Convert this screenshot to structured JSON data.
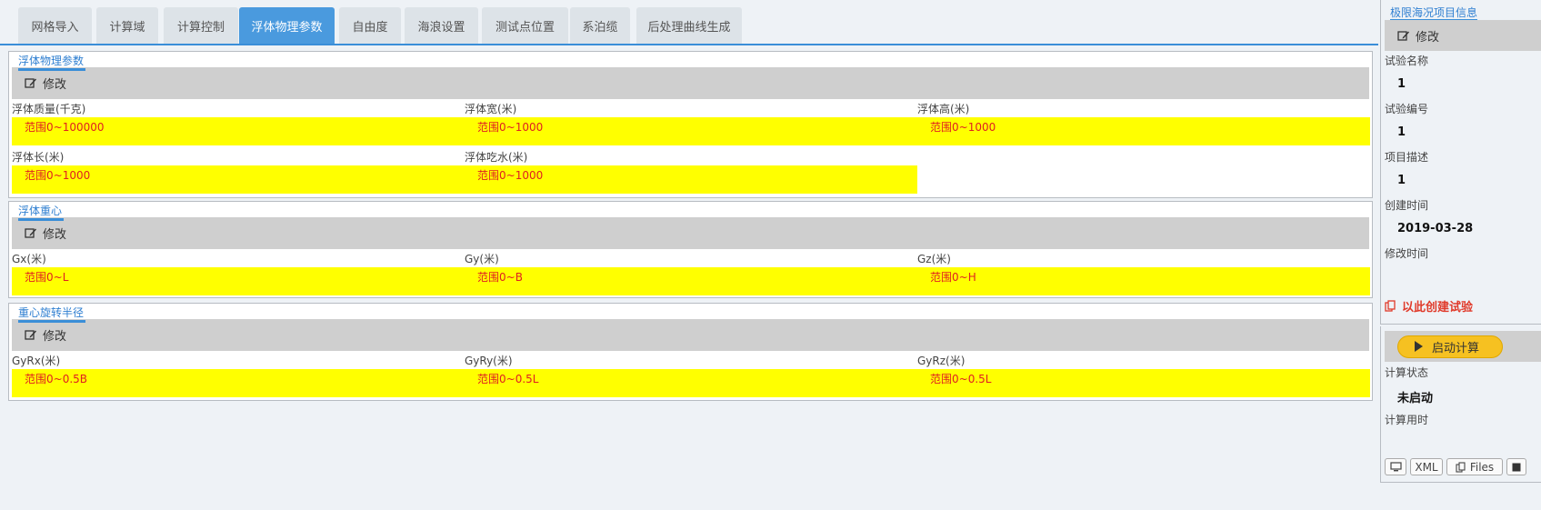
{
  "tabs": [
    "网格导入",
    "计算域",
    "计算控制",
    "浮体物理参数",
    "自由度",
    "海浪设置",
    "测试点位置",
    "系泊缆",
    "后处理曲线生成"
  ],
  "active_tab": "浮体物理参数",
  "edit_label": "修改",
  "sections": {
    "physics": {
      "title": "浮体物理参数",
      "fields": [
        {
          "label": "浮体质量(千克)",
          "placeholder": "范围0~100000"
        },
        {
          "label": "浮体宽(米)",
          "placeholder": "范围0~1000"
        },
        {
          "label": "浮体高(米)",
          "placeholder": "范围0~1000"
        },
        {
          "label": "浮体长(米)",
          "placeholder": "范围0~1000"
        },
        {
          "label": "浮体吃水(米)",
          "placeholder": "范围0~1000"
        }
      ]
    },
    "gravity": {
      "title": "浮体重心",
      "fields": [
        {
          "label": "Gx(米)",
          "placeholder": "范围0~L"
        },
        {
          "label": "Gy(米)",
          "placeholder": "范围0~B"
        },
        {
          "label": "Gz(米)",
          "placeholder": "范围0~H"
        }
      ]
    },
    "radius": {
      "title": "重心旋转半径",
      "fields": [
        {
          "label": "GyRx(米)",
          "placeholder": "范围0~0.5B"
        },
        {
          "label": "GyRy(米)",
          "placeholder": "范围0~0.5L"
        },
        {
          "label": "GyRz(米)",
          "placeholder": "范围0~0.5L"
        }
      ]
    }
  },
  "sidebar": {
    "title": "极限海况项目信息",
    "edit_label": "修改",
    "info": [
      {
        "label": "试验名称",
        "value": "1"
      },
      {
        "label": "试验编号",
        "value": "1"
      },
      {
        "label": "项目描述",
        "value": "1"
      },
      {
        "label": "创建时间",
        "value": "2019-03-28"
      },
      {
        "label": "修改时间",
        "value": ""
      }
    ],
    "create_link": "以此创建试验",
    "start_button": "启动计算",
    "status_label": "计算状态",
    "status_value": "未启动",
    "time_label": "计算用时",
    "time_value": "",
    "bottom_buttons": {
      "xml": "XML",
      "files": "Files"
    }
  },
  "colors": {
    "accent": "#3a8ed8",
    "input_bg": "#ffff00",
    "placeholder": "#e02020",
    "start_button": "#f6c121"
  }
}
